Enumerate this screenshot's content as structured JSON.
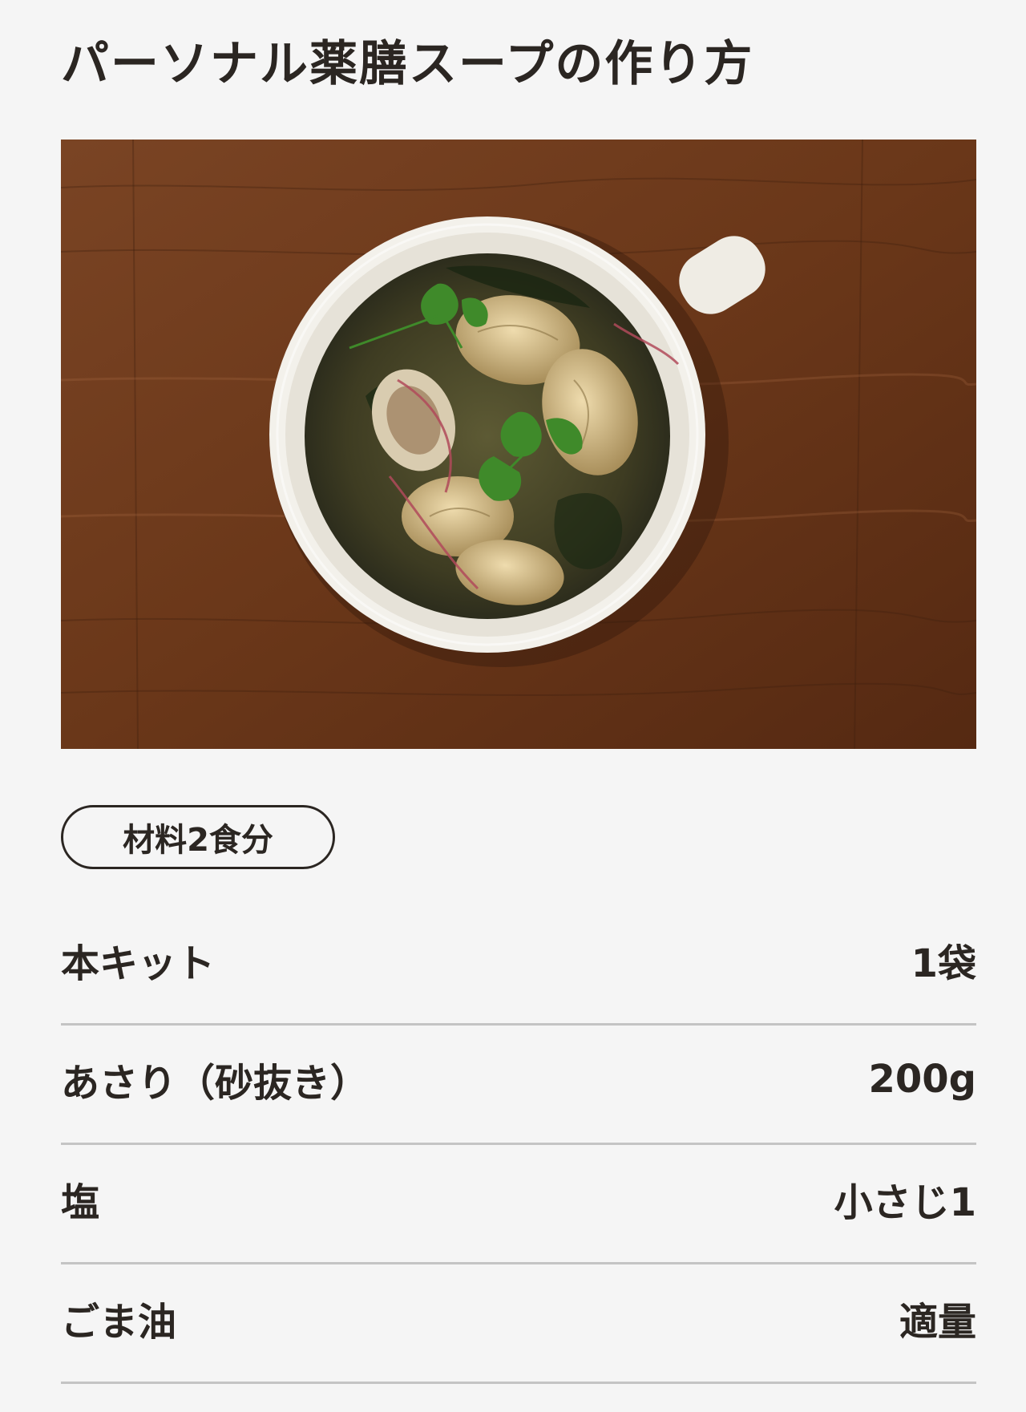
{
  "page": {
    "title": "パーソナル薬膳スープの作り方"
  },
  "photo": {
    "subject": "soup-photo"
  },
  "ingredients": {
    "badge": "材料2食分",
    "items": [
      {
        "name": "本キット",
        "quantity": "1袋"
      },
      {
        "name": "あさり（砂抜き）",
        "quantity": "200g"
      },
      {
        "name": "塩",
        "quantity": "小さじ1"
      },
      {
        "name": "ごま油",
        "quantity": "適量"
      }
    ]
  },
  "colors": {
    "background": "#f5f5f5",
    "text": "#2b2622",
    "divider": "#c4c4c4",
    "table_wood": "#6b3a1e",
    "cup": "#f2f0ea",
    "broth": "#3a3a24",
    "parsley": "#3f8a2a"
  }
}
